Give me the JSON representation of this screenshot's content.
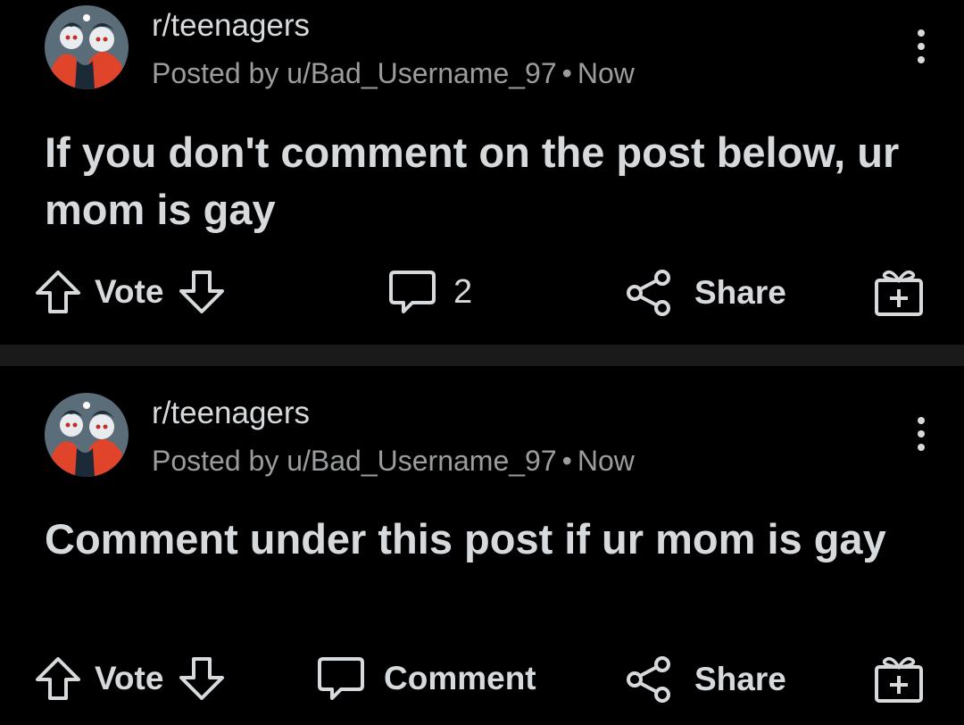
{
  "posts": [
    {
      "subreddit": "r/teenagers",
      "posted_by": "Posted by u/Bad_Username_97",
      "separator": "•",
      "time": "Now",
      "title": "If you don't comment on the post below, ur mom is gay",
      "vote_label": "Vote",
      "comment_label": "2",
      "share_label": "Share",
      "icons": [
        "upvote-arrow-icon",
        "downvote-arrow-icon",
        "comment-bubble-icon",
        "share-icon",
        "award-gift-icon",
        "more-options-icon"
      ]
    },
    {
      "subreddit": "r/teenagers",
      "posted_by": "Posted by u/Bad_Username_97",
      "separator": "•",
      "time": "Now",
      "title": "Comment under this post if ur mom is gay",
      "vote_label": "Vote",
      "comment_label": "Comment",
      "share_label": "Share",
      "icons": [
        "upvote-arrow-icon",
        "downvote-arrow-icon",
        "comment-bubble-icon",
        "share-icon",
        "award-gift-icon",
        "more-options-icon"
      ]
    }
  ],
  "colors": {
    "background": "#000000",
    "separator": "#1a1a1b",
    "text_primary": "#d7dadc",
    "text_secondary": "#9a9c9e",
    "avatar_accent": "#e0442a"
  }
}
